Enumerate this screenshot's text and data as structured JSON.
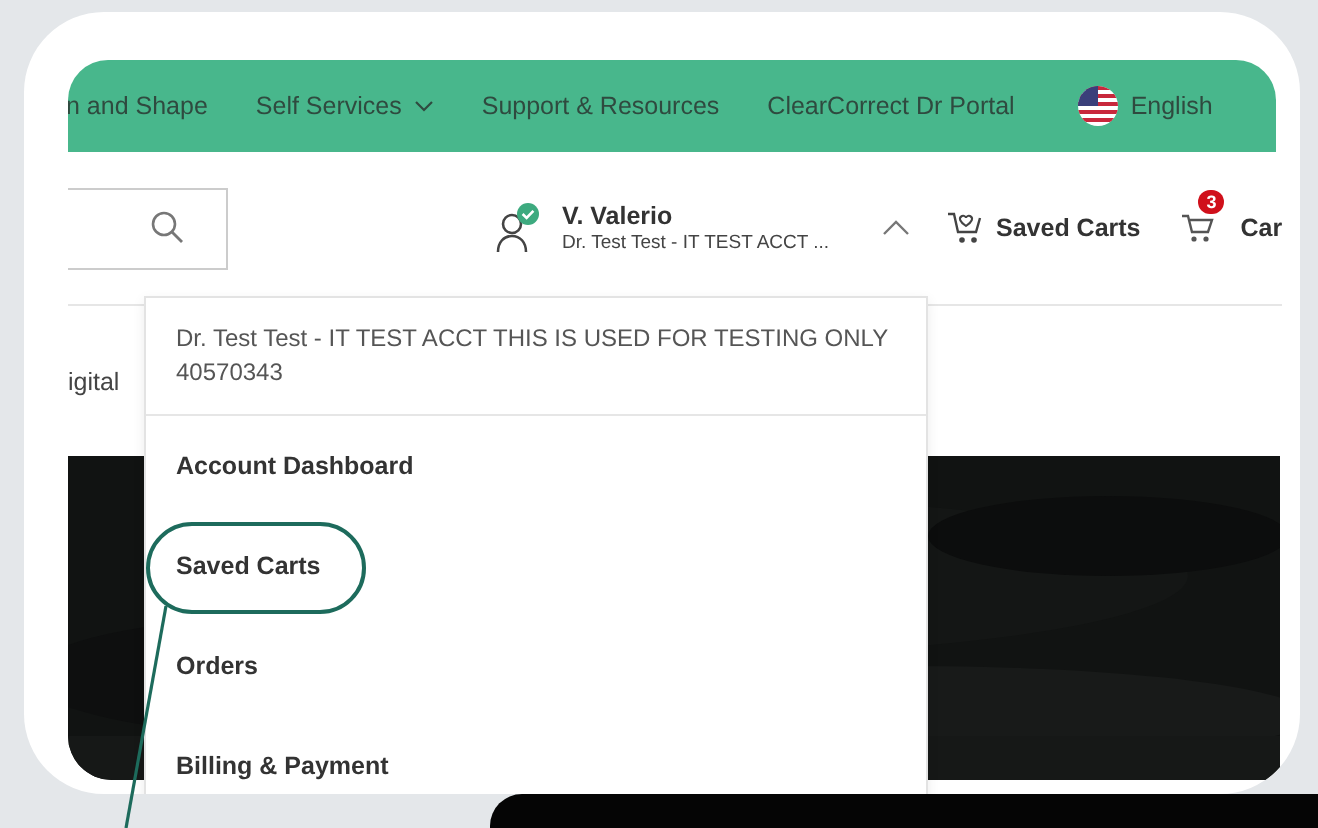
{
  "nav": {
    "items": [
      {
        "label": "n and Shape",
        "dropdown": false
      },
      {
        "label": "Self Services",
        "dropdown": true
      },
      {
        "label": "Support & Resources",
        "dropdown": false
      },
      {
        "label": "ClearCorrect Dr Portal",
        "dropdown": false
      }
    ],
    "language": "English"
  },
  "header": {
    "user": {
      "name": "V. Valerio",
      "account": "Dr. Test Test - IT TEST ACCT ...",
      "verified": true,
      "expanded": true
    },
    "saved_carts": "Saved Carts",
    "cart": {
      "label": "Car",
      "count": "3"
    }
  },
  "page": {
    "breadcrumb": "igital"
  },
  "account_menu": {
    "account": "Dr. Test Test - IT TEST ACCT THIS IS USED FOR TESTING ONLY",
    "account_number": "40570343",
    "items": [
      {
        "label": "Account Dashboard",
        "highlighted": false
      },
      {
        "label": "Saved Carts",
        "highlighted": true
      },
      {
        "label": "Orders",
        "highlighted": false
      },
      {
        "label": "Billing & Payment",
        "highlighted": false
      }
    ]
  }
}
